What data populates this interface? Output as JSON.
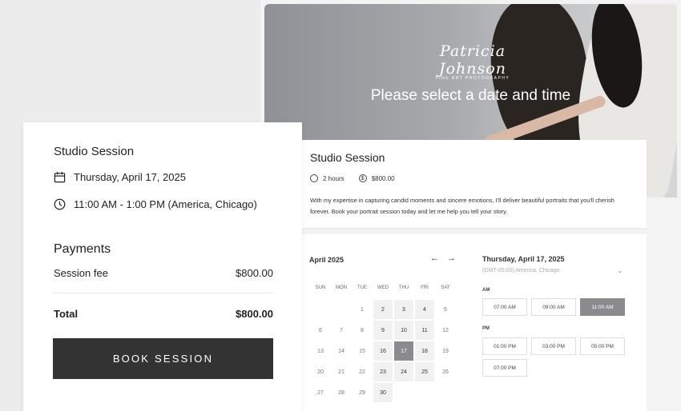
{
  "hero": {
    "signature_name": "Patricia Johnson",
    "signature_sub": "FINE ART PHOTOGRAPHY",
    "title": "Please select a date and time"
  },
  "service": {
    "title": "Studio Session",
    "duration": "2 hours",
    "price": "$800.00",
    "description": "With my expertise in capturing candid moments and sincere emotions, I'll deliver beautiful portraits that you'll cherish forever. Book your portrait session today and let me help you tell your story."
  },
  "calendar": {
    "month_label": "April 2025",
    "prev": "←",
    "next": "→",
    "weekdays": [
      "SUN",
      "MON",
      "TUE",
      "WED",
      "THU",
      "FRI",
      "SAT"
    ],
    "selected_date": "Thursday, April 17, 2025",
    "timezone": "(GMT-05:00) America, Chicago",
    "am_label": "AM",
    "pm_label": "PM",
    "am_slots": [
      "07:00 AM",
      "09:00 AM",
      "11:00 AM"
    ],
    "pm_slots": [
      "01:00 PM",
      "03:00 PM",
      "05:00 PM",
      "07:00 PM"
    ],
    "selected_slot": "11:00 AM"
  },
  "days": [
    {
      "d": "1",
      "avail": false
    },
    {
      "d": "2",
      "avail": true
    },
    {
      "d": "3",
      "avail": true
    },
    {
      "d": "4",
      "avail": true
    },
    {
      "d": "5",
      "avail": false
    },
    {
      "d": "6",
      "avail": false
    },
    {
      "d": "7",
      "avail": false
    },
    {
      "d": "8",
      "avail": false
    },
    {
      "d": "9",
      "avail": true
    },
    {
      "d": "10",
      "avail": true
    },
    {
      "d": "11",
      "avail": true
    },
    {
      "d": "12",
      "avail": false
    },
    {
      "d": "13",
      "avail": false
    },
    {
      "d": "14",
      "avail": false
    },
    {
      "d": "15",
      "avail": false
    },
    {
      "d": "16",
      "avail": true
    },
    {
      "d": "17",
      "avail": true,
      "selected": true
    },
    {
      "d": "18",
      "avail": true
    },
    {
      "d": "19",
      "avail": false
    },
    {
      "d": "20",
      "avail": false
    },
    {
      "d": "21",
      "avail": false
    },
    {
      "d": "22",
      "avail": false
    },
    {
      "d": "23",
      "avail": true
    },
    {
      "d": "24",
      "avail": true
    },
    {
      "d": "25",
      "avail": true
    },
    {
      "d": "26",
      "avail": false
    },
    {
      "d": "27",
      "avail": false
    },
    {
      "d": "28",
      "avail": false
    },
    {
      "d": "29",
      "avail": false
    },
    {
      "d": "30",
      "avail": true
    }
  ],
  "confirm": {
    "title": "Studio Session",
    "date": "Thursday, April 17, 2025",
    "time": "11:00 AM - 1:00 PM (America, Chicago)",
    "payments_title": "Payments",
    "fee_label": "Session fee",
    "fee_value": "$800.00",
    "total_label": "Total",
    "total_value": "$800.00",
    "book_label": "BOOK SESSION"
  }
}
